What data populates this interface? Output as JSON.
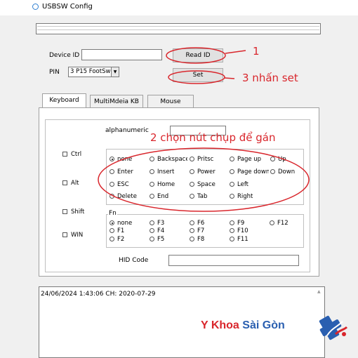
{
  "window": {
    "title": "USBSW Config"
  },
  "device": {
    "device_id_label": "Device ID",
    "device_id_value": "",
    "read_id_button": "Read ID",
    "pin_label": "PIN",
    "pin_selected": "3 P15 FootSw",
    "set_button": "Set"
  },
  "tabs": [
    {
      "label": "Keyboard"
    },
    {
      "label": "MultiMdeia KB"
    },
    {
      "label": "Mouse"
    }
  ],
  "keyboard": {
    "alphanumeric_label": "alphanumeric",
    "alphanumeric_value": "",
    "modifiers": [
      "Ctrl",
      "Alt",
      "Shift",
      "WIN"
    ],
    "keys": [
      [
        "none",
        "Backspace",
        "Pritsc",
        "Page up",
        "Up"
      ],
      [
        "Enter",
        "Insert",
        "Power",
        "Page down",
        "Down"
      ],
      [
        "ESC",
        "Home",
        "Space",
        "Left"
      ],
      [
        "Delete",
        "End",
        "Tab",
        "Right"
      ]
    ],
    "fn_label": "Fn",
    "fn_keys": [
      [
        "none",
        "F3",
        "F6",
        "F9",
        "F12"
      ],
      [
        "F1",
        "F4",
        "F7",
        "F10"
      ],
      [
        "F2",
        "F5",
        "F8",
        "F11"
      ]
    ],
    "hid_label": "HID Code",
    "hid_value": ""
  },
  "log": {
    "text": "24/06/2024 1:43:06 CH: 2020-07-29"
  },
  "annotations": {
    "a1": "1",
    "a2": "2 chọn nút chụp để gán",
    "a3": "3 nhấn set"
  },
  "brand": {
    "part1": "Y Khoa ",
    "part2": "Sài Gòn"
  },
  "colors": {
    "annotation": "#d9262c",
    "brand_blue": "#2a5fb0",
    "brand_red": "#d9262c"
  }
}
